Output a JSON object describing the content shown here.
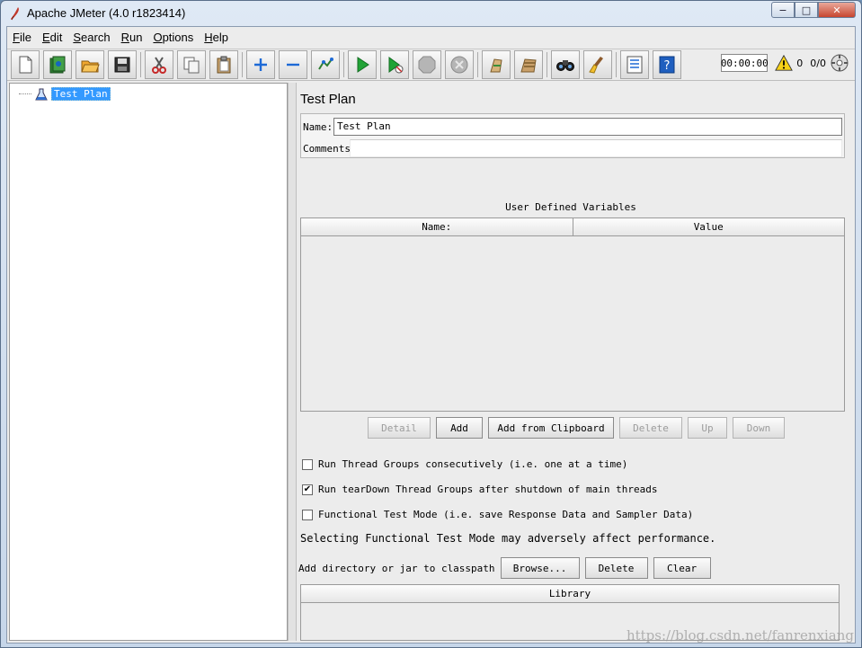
{
  "window": {
    "title": "Apache JMeter (4.0 r1823414)",
    "controls": {
      "minimize": "−",
      "maximize": "□",
      "close": "✕"
    }
  },
  "menu": [
    {
      "key": "F",
      "rest": "ile"
    },
    {
      "key": "E",
      "rest": "dit"
    },
    {
      "key": "S",
      "rest": "earch"
    },
    {
      "key": "R",
      "rest": "un"
    },
    {
      "key": "O",
      "rest": "ptions"
    },
    {
      "key": "H",
      "rest": "elp"
    }
  ],
  "toolbar": {
    "icons": [
      "new-icon",
      "templates-icon",
      "open-icon",
      "save-icon",
      "cut-icon",
      "copy-icon",
      "paste-icon",
      "expand-icon",
      "collapse-icon",
      "toggle-icon",
      "start-icon",
      "start-no-pauses-icon",
      "stop-icon",
      "shutdown-icon",
      "clear-icon",
      "clear-all-icon",
      "search-icon",
      "reset-search-icon",
      "function-helper-icon",
      "help-icon"
    ],
    "timer": "00:00:00",
    "warning_count": "0",
    "threads": "0/0"
  },
  "tree": {
    "root_label": "Test Plan"
  },
  "test_plan": {
    "title": "Test Plan",
    "name_label": "Name:",
    "name_value": "Test Plan",
    "comments_label": "Comments:",
    "comments_value": ""
  },
  "variables": {
    "title": "User Defined Variables",
    "columns": [
      "Name:",
      "Value"
    ],
    "rows": []
  },
  "variable_buttons": {
    "detail": "Detail",
    "add": "Add",
    "add_clipboard": "Add from Clipboard",
    "delete": "Delete",
    "up": "Up",
    "down": "Down"
  },
  "options": {
    "serialize": {
      "label": "Run Thread Groups consecutively (i.e. one at a time)",
      "checked": false
    },
    "teardown": {
      "label": "Run tearDown Thread Groups after shutdown of main threads",
      "checked": true
    },
    "functional": {
      "label": "Functional Test Mode (i.e. save Response Data and Sampler Data)",
      "checked": false
    }
  },
  "functional_warning": "Selecting Functional Test Mode may adversely affect performance.",
  "classpath": {
    "label": "Add directory or jar to classpath",
    "browse": "Browse...",
    "delete": "Delete",
    "clear": "Clear",
    "column": "Library"
  },
  "watermark": "https://blog.csdn.net/fanrenxiang"
}
